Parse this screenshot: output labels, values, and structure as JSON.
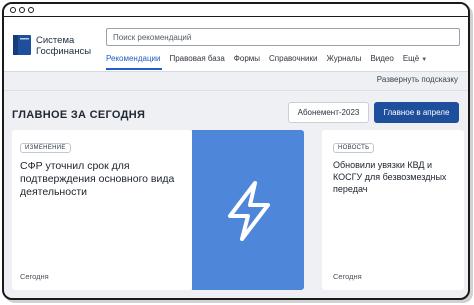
{
  "app": {
    "brand_line1": "Система",
    "brand_line2": "Госфинансы"
  },
  "search": {
    "placeholder": "Поиск рекомендаций"
  },
  "nav": {
    "items": [
      {
        "label": "Рекомендации",
        "active": true
      },
      {
        "label": "Правовая база"
      },
      {
        "label": "Формы"
      },
      {
        "label": "Справочники"
      },
      {
        "label": "Журналы"
      },
      {
        "label": "Видео"
      },
      {
        "label": "Ещё"
      }
    ]
  },
  "collapse_hint": "Развернуть подсказку",
  "section": {
    "title": "ГЛАВНОЕ ЗА СЕГОДНЯ",
    "subscription_button": "Абонемент-2023",
    "main_button": "Главное в апреле"
  },
  "cards": [
    {
      "badge": "ИЗМЕНЕНИЕ",
      "title": "СФР уточнил срок для подтверждения основного вида деятельности",
      "date": "Сегодня"
    },
    {
      "badge": "НОВОСТЬ",
      "title": "Обновили увязки КВД и КОСГУ для безвозмездных передач",
      "date": "Сегодня"
    }
  ],
  "icons": {
    "logo": "book-icon",
    "card_image": "lightning-icon"
  },
  "colors": {
    "accent": "#1f5fc6",
    "primary_button": "#1e4f9c",
    "image_bg": "#4e86d9",
    "page_bg": "#eef0f4"
  }
}
